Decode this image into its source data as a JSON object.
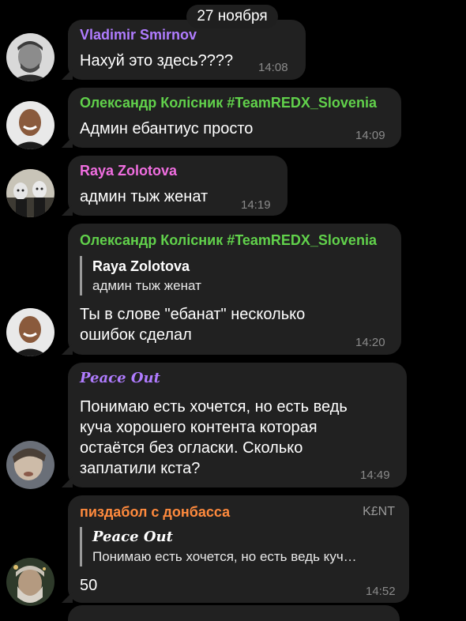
{
  "date_separator": "27 ноября",
  "colors": {
    "background": "#000000",
    "bubble": "#212121",
    "purple_name": "#b07cff",
    "green_name": "#61d14b",
    "pink_name": "#f06ee0",
    "orange_name": "#ff8a3d",
    "timestamp": "#8a8a8a"
  },
  "messages": [
    {
      "sender": "Vladimir Smirnov",
      "text": "Нахуй это здесь????",
      "time": "14:08"
    },
    {
      "sender": "Олександр Колісник #TeamREDX_Slovenia",
      "text": "Админ ебантиус просто",
      "time": "14:09"
    },
    {
      "sender": "Raya Zolotova",
      "text": "админ тыж женат",
      "time": "14:19"
    },
    {
      "sender": "Олександр Колісник #TeamREDX_Slovenia",
      "reply": {
        "sender": "Raya Zolotova",
        "text": "админ тыж женат"
      },
      "text_lines": [
        "Ты в слове \"ебанат\" несколько",
        "ошибок сделал"
      ],
      "time": "14:20"
    },
    {
      "sender": "Peace Out",
      "text_lines": [
        "Понимаю есть хочется, но есть ведь",
        "куча хорошего контента которая",
        "остаётся без огласки. Сколько",
        "заплатили кста?"
      ],
      "time": "14:49"
    },
    {
      "sender": "пиздабол с донбасса",
      "badge": "K£NT",
      "reply": {
        "sender": "Peace Out",
        "text": "Понимаю есть хочется, но есть ведь куч…"
      },
      "text": "50",
      "time": "14:52"
    }
  ]
}
